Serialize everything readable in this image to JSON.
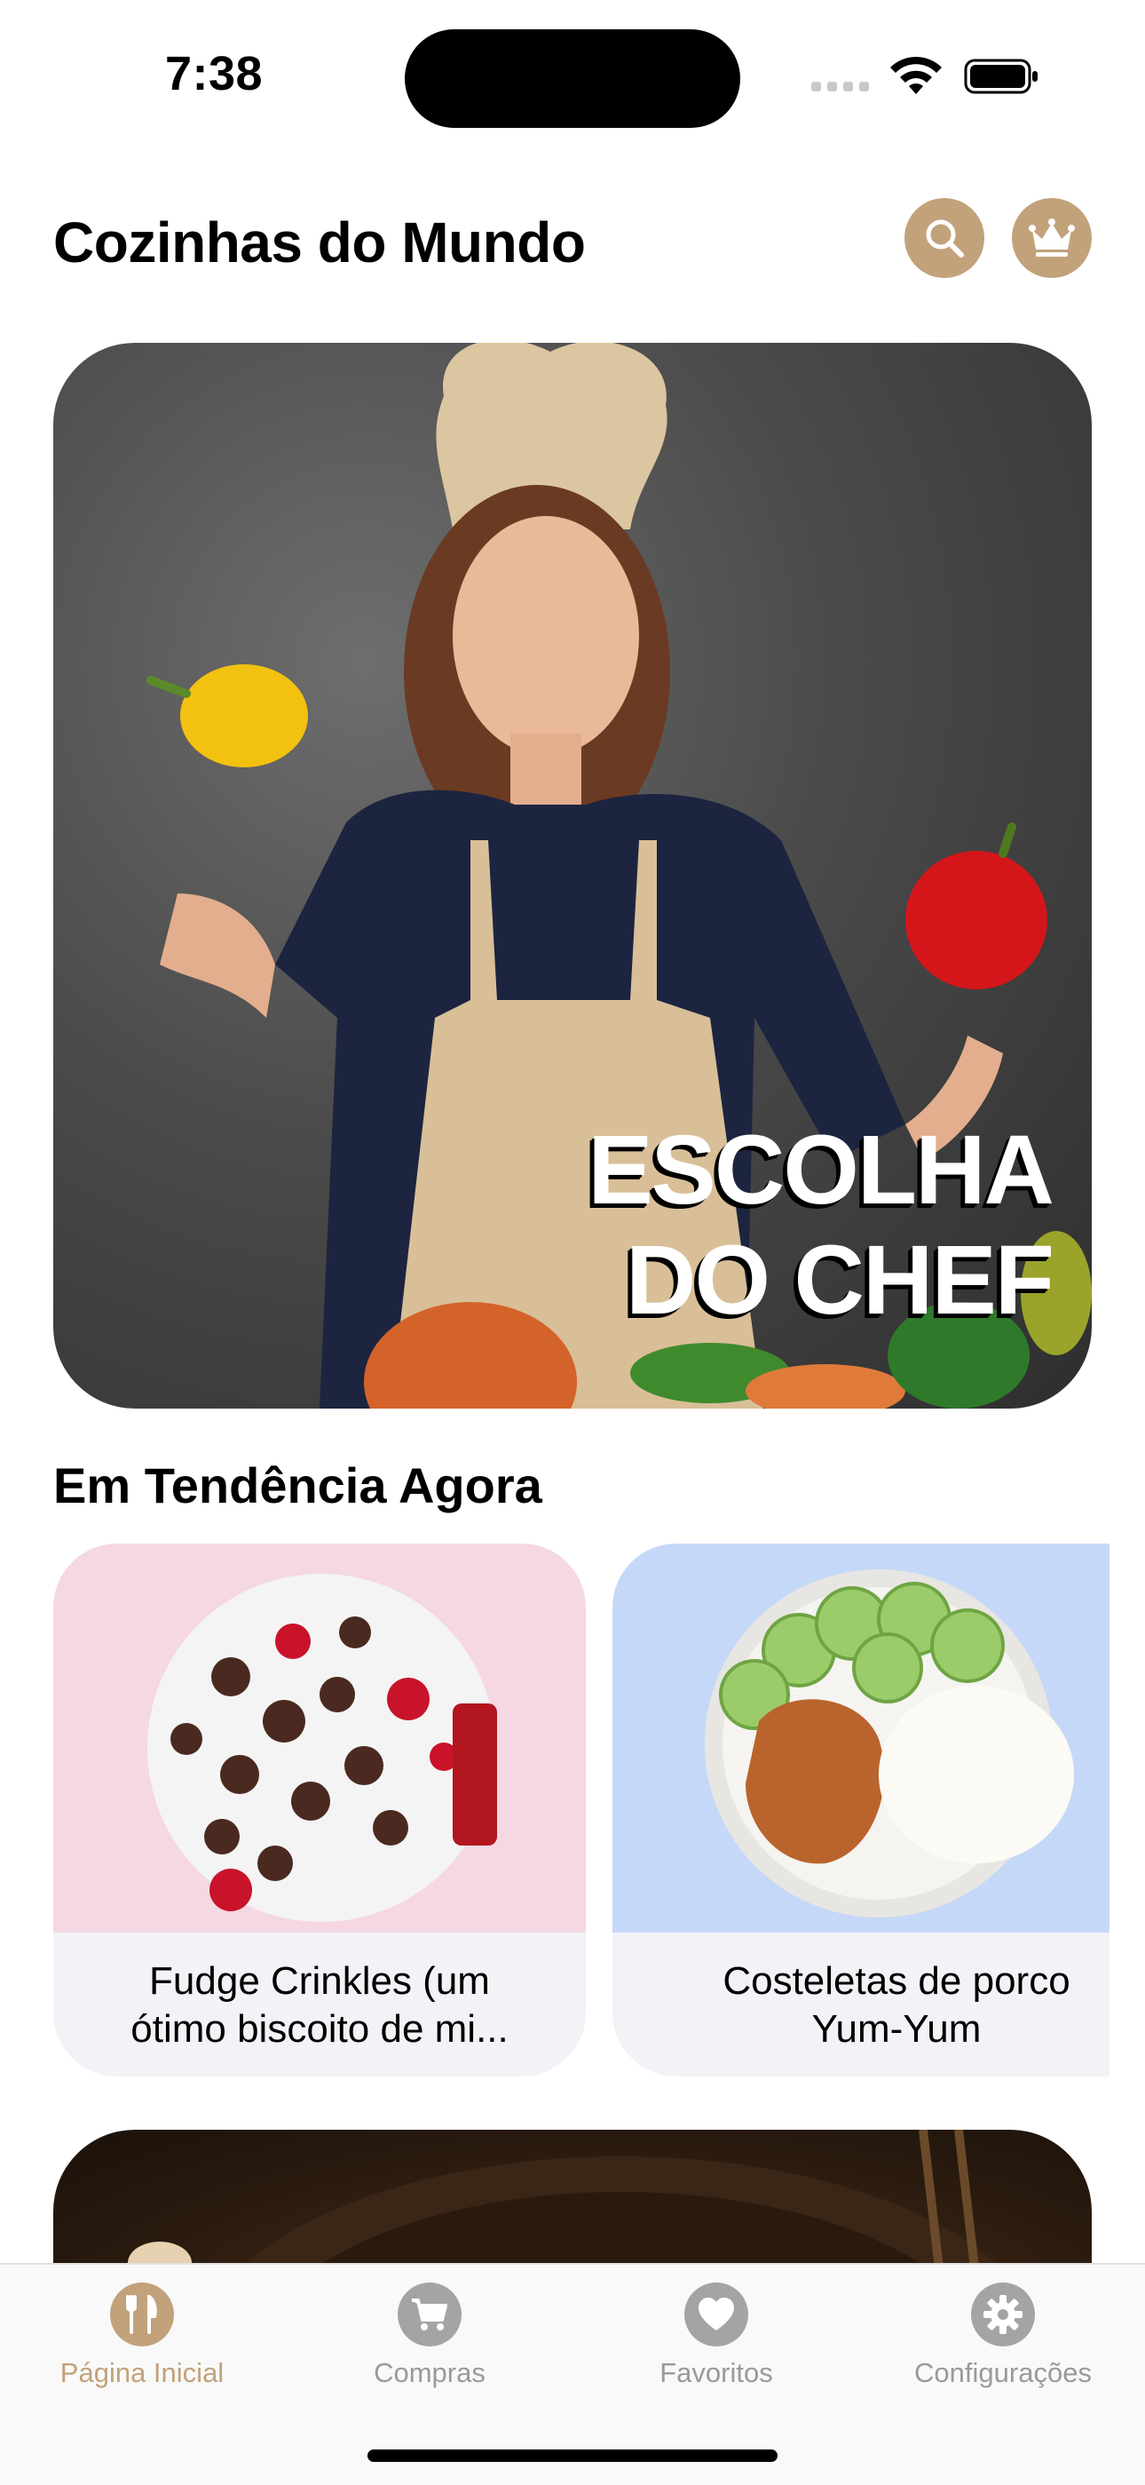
{
  "status_bar": {
    "time": "7:38"
  },
  "header": {
    "title": "Cozinhas do Mundo",
    "search_icon": "magnifier-icon",
    "premium_icon": "crown-icon",
    "accent_color": "#c2a27a"
  },
  "hero": {
    "line1": "ESCOLHA",
    "line2": "DO CHEF"
  },
  "trending": {
    "title": "Em Tendência Agora",
    "cards": [
      {
        "title_line1": "Fudge Crinkles (um",
        "title_line2": "ótimo biscoito de mi...",
        "bg_color": "#f5d8e4"
      },
      {
        "title_line1": "Costeletas de porco",
        "title_line2": "Yum-Yum",
        "bg_color": "#c5d8f8"
      }
    ]
  },
  "tabbar": {
    "items": [
      {
        "label": "Página Inicial",
        "icon": "fork-knife-icon",
        "active": true
      },
      {
        "label": "Compras",
        "icon": "cart-icon",
        "active": false
      },
      {
        "label": "Favoritos",
        "icon": "heart-icon",
        "active": false
      },
      {
        "label": "Configurações",
        "icon": "gear-icon",
        "active": false
      }
    ]
  }
}
